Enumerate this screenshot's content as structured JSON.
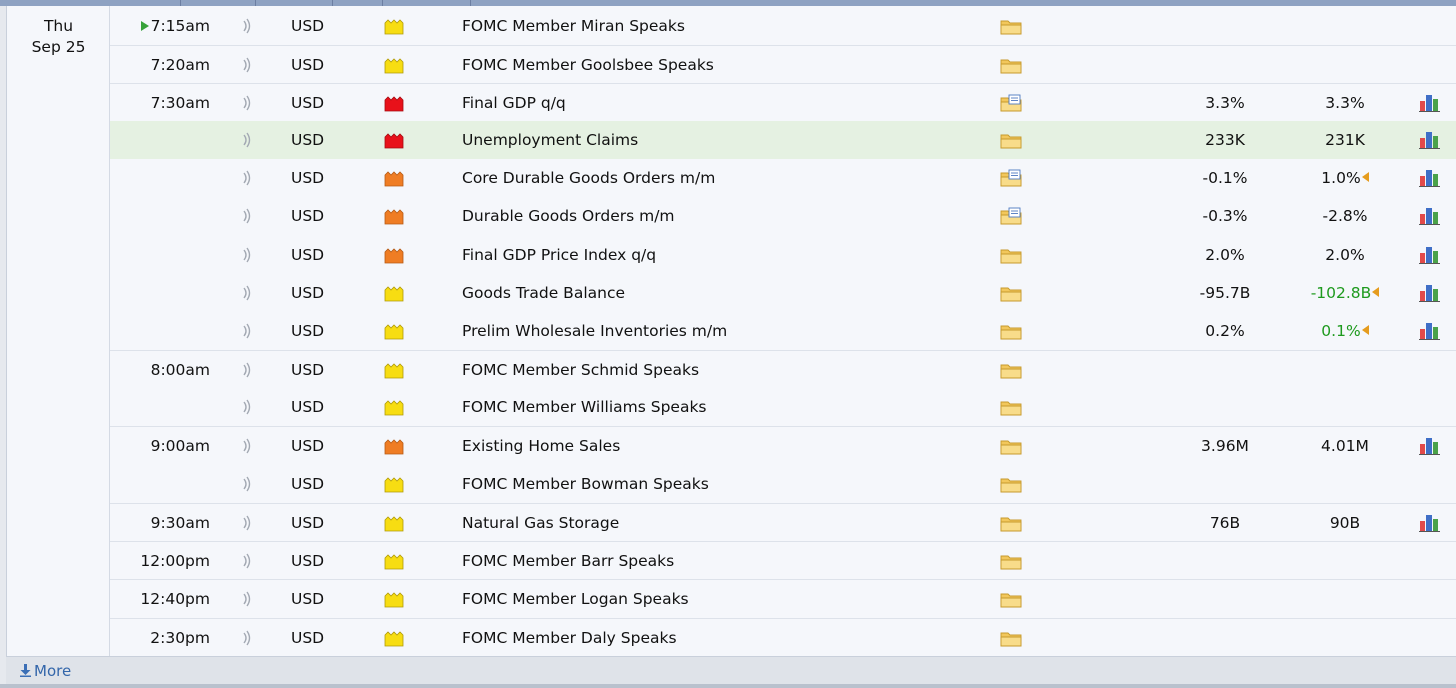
{
  "day": {
    "weekday": "Thu",
    "date": "Sep 25"
  },
  "more_label": "More",
  "colors": {
    "high": "#e8111a",
    "medium": "#ef7d24",
    "low": "#f7dd12",
    "highlight_row": "#e5f1e2",
    "better_value": "#1e9a1e",
    "revision_marker": "#e59c1e"
  },
  "rows": [
    {
      "time": "7:15am",
      "upcoming": true,
      "currency": "USD",
      "impact": "low",
      "title": "FOMC Member Miran Speaks",
      "detail_icon": "folder-icon",
      "forecast": "",
      "previous": "",
      "graph": false
    },
    {
      "time": "7:20am",
      "currency": "USD",
      "impact": "low",
      "title": "FOMC Member Goolsbee Speaks",
      "detail_icon": "folder-icon",
      "forecast": "",
      "previous": "",
      "graph": false
    },
    {
      "time": "7:30am",
      "currency": "USD",
      "impact": "high",
      "title": "Final GDP q/q",
      "detail_icon": "folder-news-icon",
      "forecast": "3.3%",
      "previous": "3.3%",
      "graph": true
    },
    {
      "time": "",
      "currency": "USD",
      "impact": "high",
      "title": "Unemployment Claims",
      "detail_icon": "folder-icon",
      "forecast": "233K",
      "previous": "231K",
      "graph": true,
      "highlight": true
    },
    {
      "time": "",
      "currency": "USD",
      "impact": "medium",
      "title": "Core Durable Goods Orders m/m",
      "detail_icon": "folder-news-icon",
      "forecast": "-0.1%",
      "previous": "1.0%",
      "revised": true,
      "graph": true
    },
    {
      "time": "",
      "currency": "USD",
      "impact": "medium",
      "title": "Durable Goods Orders m/m",
      "detail_icon": "folder-news-icon",
      "forecast": "-0.3%",
      "previous": "-2.8%",
      "graph": true
    },
    {
      "time": "",
      "currency": "USD",
      "impact": "medium",
      "title": "Final GDP Price Index q/q",
      "detail_icon": "folder-icon",
      "forecast": "2.0%",
      "previous": "2.0%",
      "graph": true
    },
    {
      "time": "",
      "currency": "USD",
      "impact": "low",
      "title": "Goods Trade Balance",
      "detail_icon": "folder-icon",
      "forecast": "-95.7B",
      "previous": "-102.8B",
      "previous_better": true,
      "revised": true,
      "graph": true
    },
    {
      "time": "",
      "currency": "USD",
      "impact": "low",
      "title": "Prelim Wholesale Inventories m/m",
      "detail_icon": "folder-icon",
      "forecast": "0.2%",
      "previous": "0.1%",
      "previous_better": true,
      "revised": true,
      "graph": true
    },
    {
      "time": "8:00am",
      "currency": "USD",
      "impact": "low",
      "title": "FOMC Member Schmid Speaks",
      "detail_icon": "folder-icon",
      "forecast": "",
      "previous": "",
      "graph": false
    },
    {
      "time": "",
      "currency": "USD",
      "impact": "low",
      "title": "FOMC Member Williams Speaks",
      "detail_icon": "folder-icon",
      "forecast": "",
      "previous": "",
      "graph": false
    },
    {
      "time": "9:00am",
      "currency": "USD",
      "impact": "medium",
      "title": "Existing Home Sales",
      "detail_icon": "folder-icon",
      "forecast": "3.96M",
      "previous": "4.01M",
      "graph": true
    },
    {
      "time": "",
      "currency": "USD",
      "impact": "low",
      "title": "FOMC Member Bowman Speaks",
      "detail_icon": "folder-icon",
      "forecast": "",
      "previous": "",
      "graph": false
    },
    {
      "time": "9:30am",
      "currency": "USD",
      "impact": "low",
      "title": "Natural Gas Storage",
      "detail_icon": "folder-icon",
      "forecast": "76B",
      "previous": "90B",
      "graph": true
    },
    {
      "time": "12:00pm",
      "currency": "USD",
      "impact": "low",
      "title": "FOMC Member Barr Speaks",
      "detail_icon": "folder-icon",
      "forecast": "",
      "previous": "",
      "graph": false
    },
    {
      "time": "12:40pm",
      "currency": "USD",
      "impact": "low",
      "title": "FOMC Member Logan Speaks",
      "detail_icon": "folder-icon",
      "forecast": "",
      "previous": "",
      "graph": false
    },
    {
      "time": "2:30pm",
      "currency": "USD",
      "impact": "low",
      "title": "FOMC Member Daly Speaks",
      "detail_icon": "folder-icon",
      "forecast": "",
      "previous": "",
      "graph": false
    }
  ]
}
